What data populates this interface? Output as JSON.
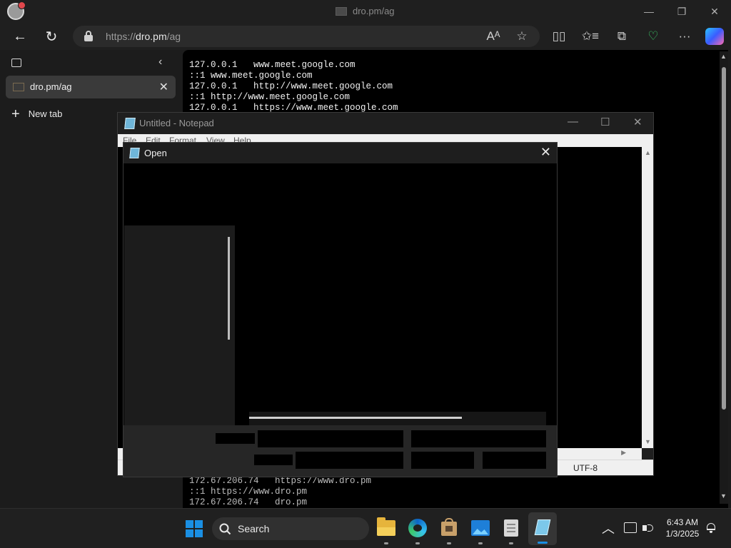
{
  "window": {
    "title": "dro.pm/ag",
    "minimize_symbol": "—",
    "maximize_symbol": "❐",
    "close_symbol": "✕"
  },
  "toolbar": {
    "back_symbol": "←",
    "refresh_symbol": "↻",
    "url_prefix": "https://",
    "url_host": "dro.pm",
    "url_path": "/ag",
    "read_aloud_symbol": "Aᴬ",
    "favorite_symbol": "☆",
    "split_screen_symbol": "▯▯",
    "favorites_symbol": "✩≡",
    "collections_symbol": "⧉",
    "browser_essentials_symbol": "♡",
    "more_symbol": "···"
  },
  "sidebar": {
    "collapse_symbol": "‹",
    "active_tab": {
      "label": "dro.pm/ag",
      "close_symbol": "✕"
    },
    "new_tab": {
      "symbol": "+",
      "label": "New tab"
    }
  },
  "page": {
    "top_lines": "127.0.0.1   www.meet.google.com\n::1 www.meet.google.com\n127.0.0.1   http://www.meet.google.com\n::1 http://www.meet.google.com\n127.0.0.1   https://www.meet.google.com",
    "bottom_lines": "172.67.206.74   https://www.dro.pm\n::1 https://www.dro.pm\n172.67.206.74   dro.pm",
    "scroll_up": "▲",
    "scroll_down": "▼"
  },
  "notepad": {
    "title": "Untitled - Notepad",
    "minimize_symbol": "—",
    "maximize_symbol": "☐",
    "close_symbol": "✕",
    "menu": [
      "File",
      "Edit",
      "Format",
      "View",
      "Help"
    ],
    "scroll_up": "▲",
    "scroll_down": "▼",
    "scroll_right": "▶",
    "encoding": "UTF-8"
  },
  "open_dialog": {
    "title": "Open",
    "close_symbol": "✕"
  },
  "taskbar": {
    "search_placeholder": "Search",
    "tray_chevron": "︿",
    "time": "6:43 AM",
    "date": "1/3/2025"
  },
  "colors": {
    "accent": "#1a8fe3",
    "windows_logo": "#1a8fe3",
    "taskbar": "#202020"
  }
}
